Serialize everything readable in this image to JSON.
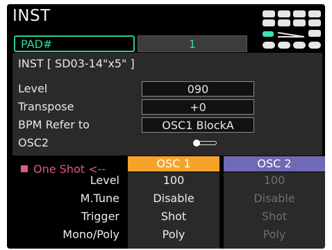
{
  "header": {
    "title": "INST"
  },
  "pad": {
    "label": "PAD#",
    "value": "1"
  },
  "inst": {
    "name": "INST [ SD03-14\"x5\" ]",
    "params": [
      {
        "label": "Level",
        "value": "090"
      },
      {
        "label": "Transpose",
        "value": "+0"
      },
      {
        "label": "BPM Refer to",
        "value": "OSC1 BlockA"
      }
    ],
    "osc2": {
      "label": "OSC2",
      "state": "off"
    }
  },
  "mode": {
    "label": "One Shot <--"
  },
  "columns": {
    "osc1": "OSC 1",
    "osc2": "OSC 2"
  },
  "rows": [
    {
      "label": "Level",
      "osc1": "100",
      "osc2": "100"
    },
    {
      "label": "M.Tune",
      "osc1": "Disable",
      "osc2": "Disable"
    },
    {
      "label": "Trigger",
      "osc1": "Shot",
      "osc2": "Shot"
    },
    {
      "label": "Mono/Poly",
      "osc1": "Poly",
      "osc2": "Poly"
    }
  ],
  "colors": {
    "accent_green": "#36d99a",
    "osc1": "#f5a32a",
    "osc2": "#6e6ab5",
    "mode": "#e0587e",
    "pad_selected": "#3ee0b8"
  },
  "icons": {
    "pad_grid": "pad-grid-icon",
    "toggle": "toggle-switch-icon"
  }
}
